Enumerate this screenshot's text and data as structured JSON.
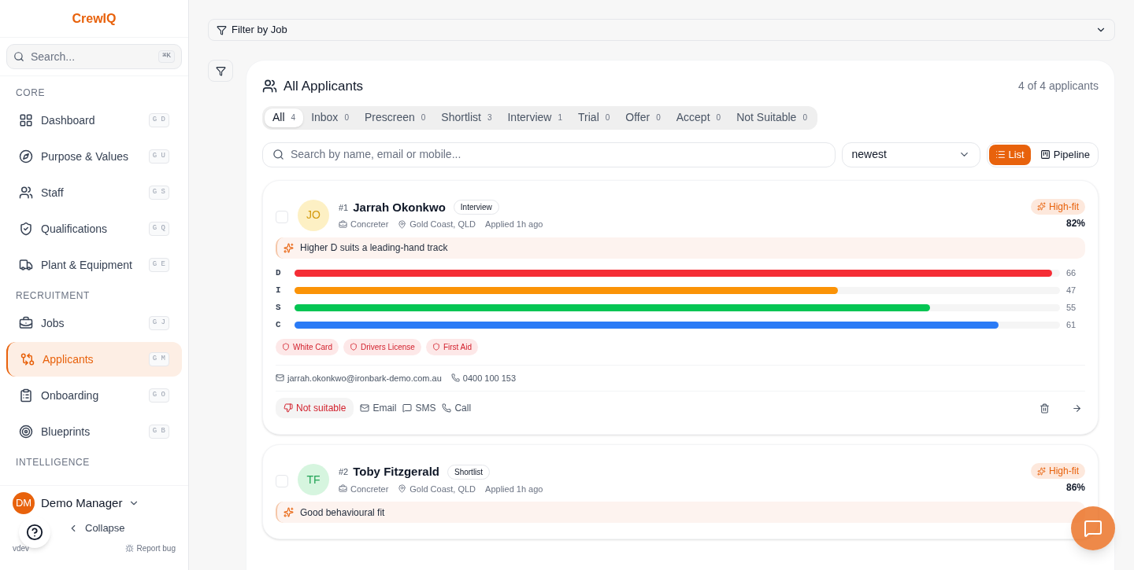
{
  "sidebar": {
    "brand": "CrewIQ",
    "search": {
      "placeholder": "Search...",
      "shortcut": "⌘K"
    },
    "sections": [
      {
        "title": "CORE",
        "items": [
          {
            "label": "Dashboard",
            "shortcut": "G D",
            "selected": false
          },
          {
            "label": "Purpose & Values",
            "shortcut": "G U",
            "selected": false
          },
          {
            "label": "Staff",
            "shortcut": "G S",
            "selected": false
          },
          {
            "label": "Qualifications",
            "shortcut": "G Q",
            "selected": false
          },
          {
            "label": "Plant & Equipment",
            "shortcut": "G E",
            "selected": false
          }
        ]
      },
      {
        "title": "RECRUITMENT",
        "items": [
          {
            "label": "Jobs",
            "shortcut": "G J",
            "selected": false
          },
          {
            "label": "Applicants",
            "shortcut": "G M",
            "selected": true
          },
          {
            "label": "Onboarding",
            "shortcut": "G O",
            "selected": false
          },
          {
            "label": "Blueprints",
            "shortcut": "G B",
            "selected": false
          }
        ]
      },
      {
        "title": "INTELLIGENCE"
      }
    ],
    "user": {
      "initials": "DM",
      "name": "Demo Manager"
    },
    "collapse": "Collapse",
    "version": "vdev",
    "report": "Report bug"
  },
  "filter": {
    "label": "Filter by Job"
  },
  "panel": {
    "title": "All Applicants",
    "count": "4 of 4 applicants",
    "tabs": [
      {
        "label": "All",
        "count": "4",
        "selected": true
      },
      {
        "label": "Inbox",
        "count": "0",
        "selected": false
      },
      {
        "label": "Prescreen",
        "count": "0",
        "selected": false
      },
      {
        "label": "Shortlist",
        "count": "3",
        "selected": false
      },
      {
        "label": "Interview",
        "count": "1",
        "selected": false
      },
      {
        "label": "Trial",
        "count": "0",
        "selected": false
      },
      {
        "label": "Offer",
        "count": "0",
        "selected": false
      },
      {
        "label": "Accept",
        "count": "0",
        "selected": false
      },
      {
        "label": "Not Suitable",
        "count": "0",
        "selected": false
      }
    ],
    "search": {
      "placeholder": "Search by name, email or mobile..."
    },
    "sort": {
      "value": "newest"
    },
    "views": [
      {
        "label": "List",
        "selected": true
      },
      {
        "label": "Pipeline",
        "selected": false
      }
    ],
    "cards": [
      {
        "checked": false,
        "initials": "JO",
        "color": "#fdf0c4",
        "number": "#1",
        "name": "Jarrah Okonkwo",
        "stage": "Interview",
        "role": "Concreter",
        "location": "Gold Coast, QLD",
        "applied": "Applied 1h ago",
        "fit": "High-fit",
        "score": "82%",
        "insight": "Higher D suits a leading-hand track",
        "disc": [
          {
            "letter": "D",
            "level": 0.99,
            "value": "66",
            "color": "#f52d35"
          },
          {
            "letter": "I",
            "level": 0.71,
            "value": "47",
            "color": "#fb9306"
          },
          {
            "letter": "S",
            "level": 0.83,
            "value": "55",
            "color": "#04c553"
          },
          {
            "letter": "C",
            "level": 0.92,
            "value": "61",
            "color": "#2a7bf6"
          }
        ],
        "tags": [
          "White Card",
          "Drivers License",
          "First Aid"
        ],
        "email": "jarrah.okonkwo@ironbark-demo.com.au",
        "phone": "0400 100 153",
        "actions": {
          "reject": "Not suitable",
          "email": "Email",
          "sms": "SMS",
          "call": "Call"
        }
      },
      {
        "checked": false,
        "initials": "TF",
        "color": "#d6f5df",
        "number": "#2",
        "name": "Toby Fitzgerald",
        "stage": "Shortlist",
        "role": "Concreter",
        "location": "Gold Coast, QLD",
        "applied": "Applied 1h ago",
        "fit": "High-fit",
        "score": "86%",
        "insight": "Good behavioural fit"
      }
    ]
  }
}
